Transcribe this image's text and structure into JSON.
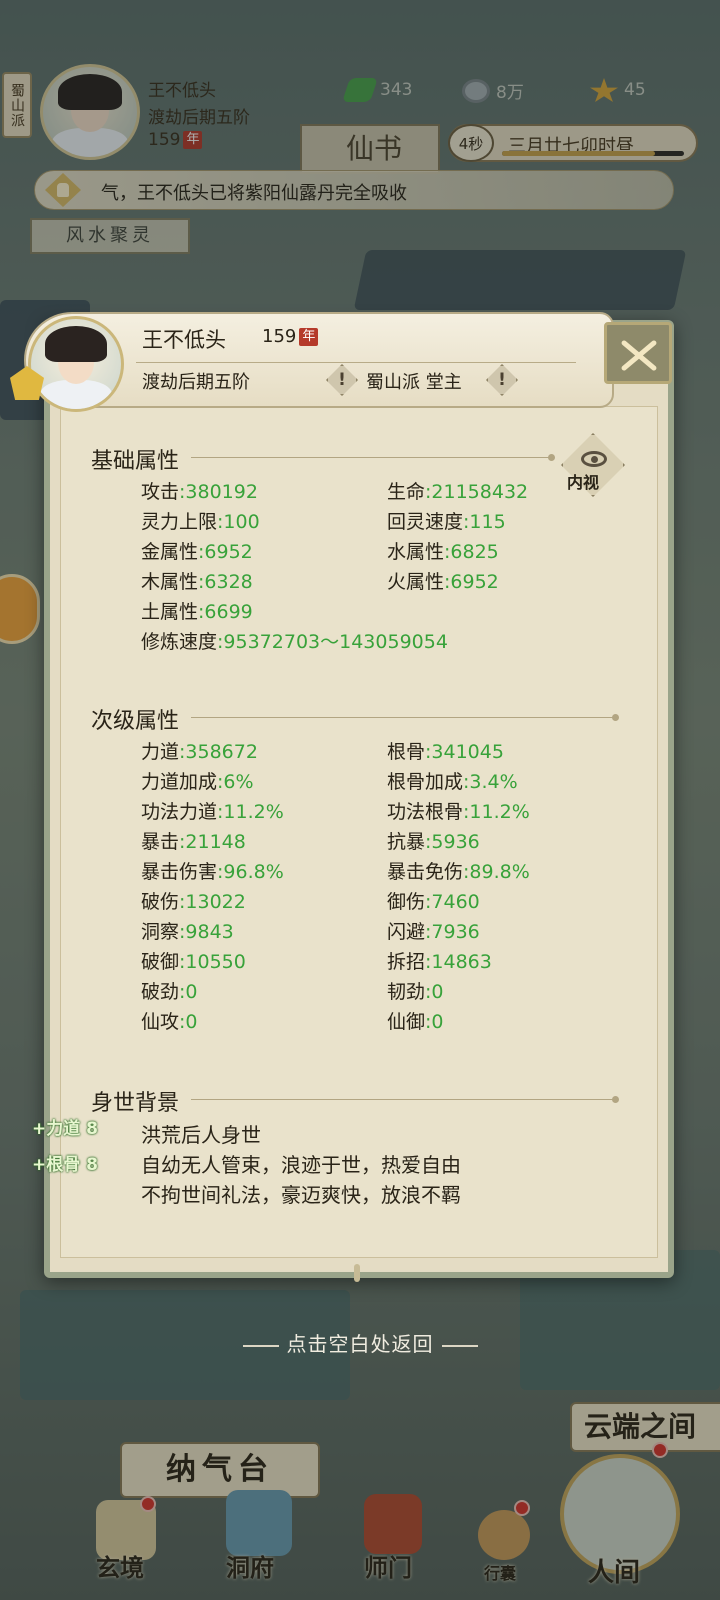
{
  "hud": {
    "sect_tag": "蜀山派",
    "name": "王不低头",
    "realm": "渡劫后期五阶",
    "age": "159",
    "age_unit": "年",
    "resources": [
      {
        "icon": "jade-leaf-icon",
        "value": "343"
      },
      {
        "icon": "spirit-coin-icon",
        "value": "8万"
      },
      {
        "icon": "gold-token-icon",
        "value": "45"
      }
    ],
    "plaque_char": "仙书",
    "timer": {
      "countdown": "4秒",
      "date_text": "三月廿七卯时昼",
      "progress": 0.84
    }
  },
  "notice": {
    "text": "气，王不低头已将紫阳仙露丹完全吸收"
  },
  "fengshui_label": "风水聚灵",
  "modal": {
    "name": "王不低头",
    "age": "159",
    "age_unit": "年",
    "realm": "渡劫后期五阶",
    "sect_role": "蜀山派 堂主",
    "inner_view_label": "内视",
    "sections": {
      "basic": {
        "title": "基础属性",
        "rows": [
          [
            {
              "label": "攻击",
              "value": "380192"
            },
            {
              "label": "生命",
              "value": "21158432"
            }
          ],
          [
            {
              "label": "灵力上限",
              "value": "100"
            },
            {
              "label": "回灵速度",
              "value": "115"
            }
          ],
          [
            {
              "label": "金属性",
              "value": "6952"
            },
            {
              "label": "水属性",
              "value": "6825"
            }
          ],
          [
            {
              "label": "木属性",
              "value": "6328"
            },
            {
              "label": "火属性",
              "value": "6952"
            }
          ],
          [
            {
              "label": "土属性",
              "value": "6699"
            }
          ],
          [
            {
              "label": "修炼速度",
              "value": "95372703～143059054"
            }
          ]
        ]
      },
      "secondary": {
        "title": "次级属性",
        "rows": [
          [
            {
              "label": "力道",
              "value": "358672"
            },
            {
              "label": "根骨",
              "value": "341045"
            }
          ],
          [
            {
              "label": "力道加成",
              "value": "6%"
            },
            {
              "label": "根骨加成",
              "value": "3.4%"
            }
          ],
          [
            {
              "label": "功法力道",
              "value": "11.2%"
            },
            {
              "label": "功法根骨",
              "value": "11.2%"
            }
          ],
          [
            {
              "label": "暴击",
              "value": "21148"
            },
            {
              "label": "抗暴",
              "value": "5936"
            }
          ],
          [
            {
              "label": "暴击伤害",
              "value": "96.8%"
            },
            {
              "label": "暴击免伤",
              "value": "89.8%"
            }
          ],
          [
            {
              "label": "破伤",
              "value": "13022"
            },
            {
              "label": "御伤",
              "value": "7460"
            }
          ],
          [
            {
              "label": "洞察",
              "value": "9843"
            },
            {
              "label": "闪避",
              "value": "7936"
            }
          ],
          [
            {
              "label": "破御",
              "value": "10550"
            },
            {
              "label": "拆招",
              "value": "14863"
            }
          ],
          [
            {
              "label": "破劲",
              "value": "0"
            },
            {
              "label": "韧劲",
              "value": "0"
            }
          ],
          [
            {
              "label": "仙攻",
              "value": "0"
            },
            {
              "label": "仙御",
              "value": "0"
            }
          ]
        ]
      },
      "background": {
        "title": "身世背景",
        "lines": [
          "洪荒后人身世",
          "自幼无人管束，浪迹于世，热爱自由",
          "不拘世间礼法，豪迈爽快，放浪不羁"
        ]
      }
    },
    "float_tags": [
      "+力道 8",
      "+根骨 8"
    ]
  },
  "return_hint": "点击空白处返回",
  "nav": {
    "naqitai": "纳气台",
    "yunduan": "云端之间",
    "items": [
      "玄境",
      "洞府",
      "师门",
      "行囊",
      "人间"
    ]
  }
}
